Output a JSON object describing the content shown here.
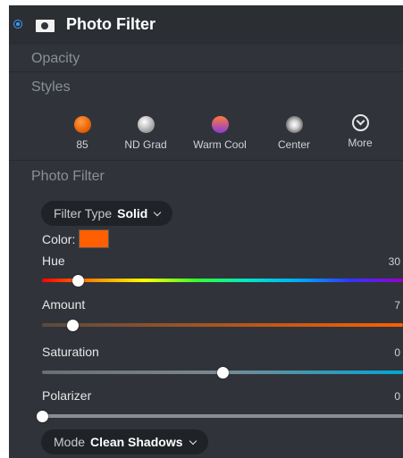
{
  "header": {
    "title": "Photo Filter"
  },
  "opacity": {
    "label": "Opacity"
  },
  "styles": {
    "label": "Styles",
    "items": [
      {
        "label": "85",
        "icon": "orange-circle-swatch-icon"
      },
      {
        "label": "ND Grad",
        "icon": "gray-circle-swatch-icon"
      },
      {
        "label": "Warm Cool",
        "icon": "warm-cool-circle-swatch-icon"
      },
      {
        "label": "Center",
        "icon": "center-vignette-swatch-icon"
      },
      {
        "label": "More",
        "icon": "chevron-circle-down-icon"
      }
    ]
  },
  "photo_filter": {
    "label": "Photo Filter",
    "filter_type": {
      "label": "Filter Type",
      "value": "Solid"
    },
    "color": {
      "label": "Color:",
      "value": "#ff5f00"
    },
    "sliders": {
      "hue": {
        "label": "Hue",
        "value": "30",
        "level": 0.1
      },
      "amount": {
        "label": "Amount",
        "value": "7",
        "level": 0.085
      },
      "saturation": {
        "label": "Saturation",
        "value": "0",
        "level": 0.5
      },
      "polarizer": {
        "label": "Polarizer",
        "value": "0",
        "level": 0.0
      }
    },
    "mode": {
      "label": "Mode",
      "value": "Clean Shadows"
    }
  },
  "colors": {
    "accent": "#3a9cff",
    "panel_bg": "#30343a",
    "swatch": "#ff5f00"
  }
}
